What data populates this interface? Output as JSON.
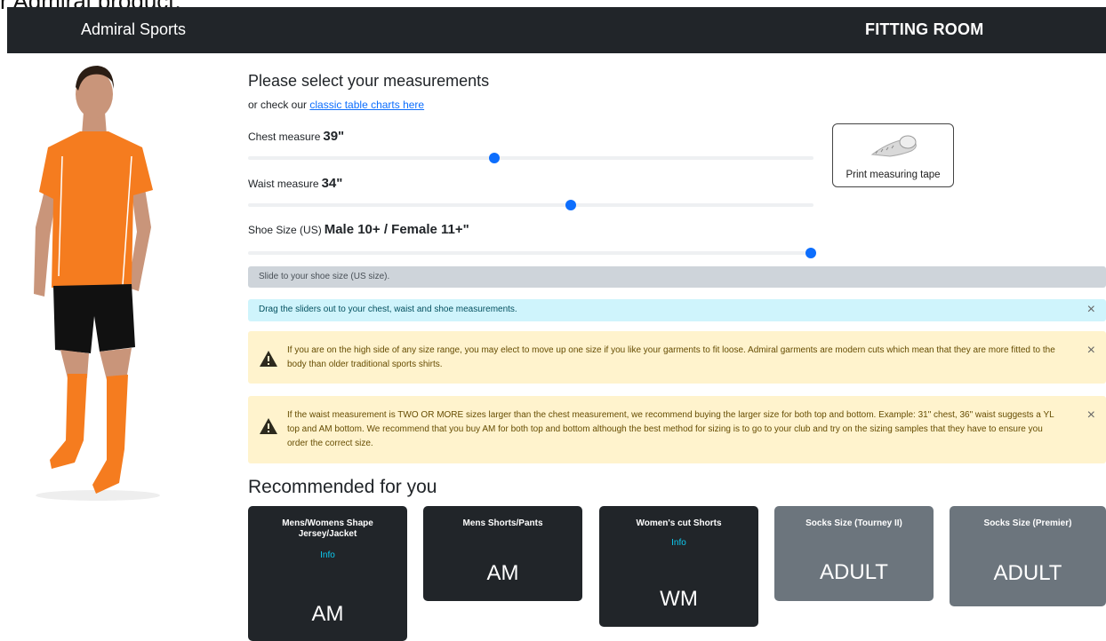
{
  "page_top_text": "r Admiral product.",
  "navbar": {
    "brand": "Admiral Sports",
    "section": "FITTING ROOM"
  },
  "title": "Please select your measurements",
  "subline": {
    "prefix": "or check our ",
    "link": "classic table charts here"
  },
  "measurements": [
    {
      "label": "Chest measure",
      "value": "39\"",
      "slider_fraction": 0.435
    },
    {
      "label": "Waist measure",
      "value": "34\"",
      "slider_fraction": 0.57
    },
    {
      "label": "Shoe Size (US)",
      "value": "Male 10+ / Female 11+\"",
      "slider_fraction": 0.995
    }
  ],
  "print_button": {
    "label": "Print measuring tape",
    "icon": "measuring-tape-icon"
  },
  "hint": "Slide to your shoe size (US size).",
  "alerts": {
    "info": "Drag the sliders out to your chest, waist and shoe measurements.",
    "warning1": "If you are on the high side of any size range, you may elect to move up one size if you like your garments to fit loose. Admiral garments are modern cuts which mean that they are more fitted to the body than older traditional sports shirts.",
    "warning2": "If the waist measurement is TWO OR MORE sizes larger than the chest measurement, we recommend buying the larger size for both top and bottom. Example: 31\" chest, 36\" waist suggests a YL top and AM bottom. We recommend that you buy AM for both top and bottom although the best method for sizing is to go to your club and try on the sizing samples that they have to ensure you order the correct size.",
    "close_glyph": "×"
  },
  "recommended_title": "Recommended for you",
  "cards": [
    {
      "title": "Mens/Womens Shape Jersey/Jacket",
      "info": "Info",
      "size": "AM"
    },
    {
      "title": "Mens Shorts/Pants",
      "info": "",
      "size": "AM"
    },
    {
      "title": "Women's cut Shorts",
      "info": "Info",
      "size": "WM"
    },
    {
      "title": "Socks Size (Tourney II)",
      "info": "",
      "size": "ADULT"
    },
    {
      "title": "Socks Size (Premier)",
      "info": "",
      "size": "ADULT"
    }
  ],
  "colors": {
    "navbar": "#212529",
    "accent": "#0d6efd",
    "jersey": "#f57c1f",
    "info_bg": "#cff4fc",
    "warn_bg": "#fff3cd",
    "card_dark": "#212529",
    "card_grey": "#6c757d"
  }
}
